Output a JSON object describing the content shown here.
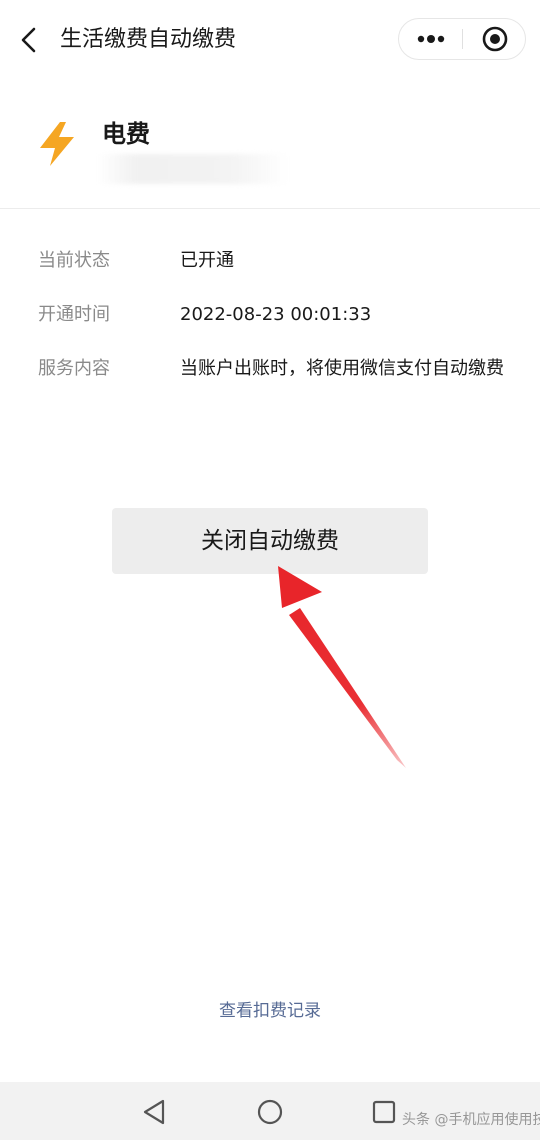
{
  "header": {
    "title": "生活缴费自动缴费",
    "back_icon": "back-chevron-icon",
    "more_icon": "more-dots-icon",
    "close_icon": "miniprogram-close-icon"
  },
  "biller": {
    "name": "电费",
    "icon": "lightning-bolt-icon",
    "icon_color": "#F5A623"
  },
  "info": [
    {
      "label": "当前状态",
      "value": "已开通"
    },
    {
      "label": "开通时间",
      "value": "2022-08-23 00:01:33"
    },
    {
      "label": "服务内容",
      "value": "当账户出账时，将使用微信支付自动缴费"
    }
  ],
  "primary_button": {
    "label": "关闭自动缴费"
  },
  "records_link": {
    "label": "查看扣费记录",
    "color": "#576B95"
  },
  "annotation": {
    "arrow_color": "#E8252A"
  },
  "nav_bar": {
    "back_icon": "nav-back-triangle-icon",
    "home_icon": "nav-home-circle-icon",
    "recents_icon": "nav-recents-square-icon"
  },
  "watermark": {
    "text": "头条 @手机应用使用技"
  }
}
